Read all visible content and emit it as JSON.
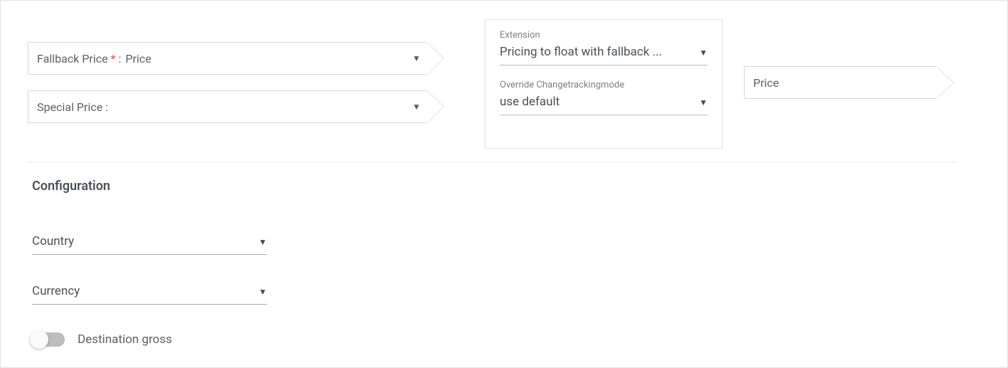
{
  "fields": {
    "fallback_price": {
      "label": "Fallback Price",
      "required_marker": "*",
      "separator": ":",
      "value": "Price"
    },
    "special_price": {
      "label": "Special Price :",
      "value": ""
    },
    "price_display": {
      "label": "Price"
    }
  },
  "panel": {
    "extension_label": "Extension",
    "extension_value": "Pricing to float with fallback ...",
    "override_label": "Override Changetrackingmode",
    "override_value": "use default"
  },
  "config": {
    "section_title": "Configuration",
    "country_label": "Country",
    "country_value": "",
    "currency_label": "Currency",
    "currency_value": "",
    "destination_gross_label": "Destination gross",
    "destination_gross_on": false
  }
}
